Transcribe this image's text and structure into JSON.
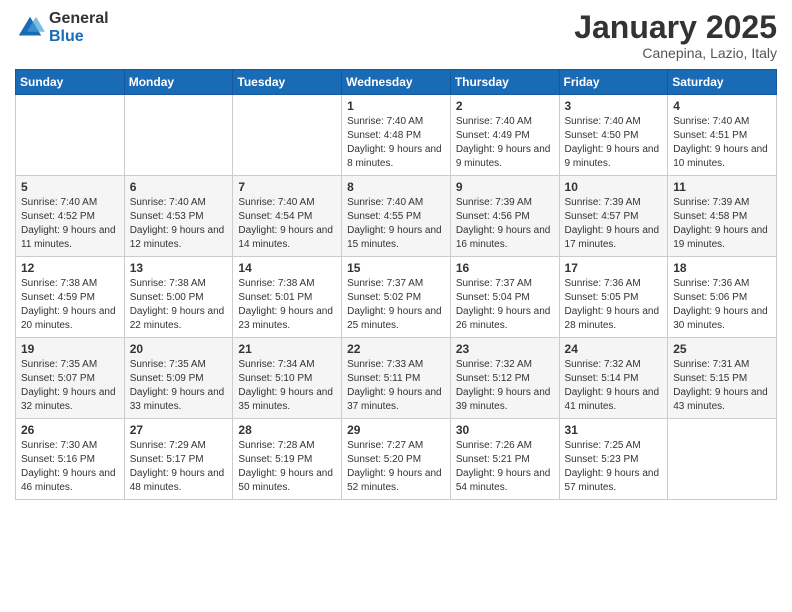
{
  "logo": {
    "general": "General",
    "blue": "Blue"
  },
  "title": {
    "month": "January 2025",
    "location": "Canepina, Lazio, Italy"
  },
  "weekdays": [
    "Sunday",
    "Monday",
    "Tuesday",
    "Wednesday",
    "Thursday",
    "Friday",
    "Saturday"
  ],
  "weeks": [
    [
      {
        "day": "",
        "info": ""
      },
      {
        "day": "",
        "info": ""
      },
      {
        "day": "",
        "info": ""
      },
      {
        "day": "1",
        "info": "Sunrise: 7:40 AM\nSunset: 4:48 PM\nDaylight: 9 hours and 8 minutes."
      },
      {
        "day": "2",
        "info": "Sunrise: 7:40 AM\nSunset: 4:49 PM\nDaylight: 9 hours and 9 minutes."
      },
      {
        "day": "3",
        "info": "Sunrise: 7:40 AM\nSunset: 4:50 PM\nDaylight: 9 hours and 9 minutes."
      },
      {
        "day": "4",
        "info": "Sunrise: 7:40 AM\nSunset: 4:51 PM\nDaylight: 9 hours and 10 minutes."
      }
    ],
    [
      {
        "day": "5",
        "info": "Sunrise: 7:40 AM\nSunset: 4:52 PM\nDaylight: 9 hours and 11 minutes."
      },
      {
        "day": "6",
        "info": "Sunrise: 7:40 AM\nSunset: 4:53 PM\nDaylight: 9 hours and 12 minutes."
      },
      {
        "day": "7",
        "info": "Sunrise: 7:40 AM\nSunset: 4:54 PM\nDaylight: 9 hours and 14 minutes."
      },
      {
        "day": "8",
        "info": "Sunrise: 7:40 AM\nSunset: 4:55 PM\nDaylight: 9 hours and 15 minutes."
      },
      {
        "day": "9",
        "info": "Sunrise: 7:39 AM\nSunset: 4:56 PM\nDaylight: 9 hours and 16 minutes."
      },
      {
        "day": "10",
        "info": "Sunrise: 7:39 AM\nSunset: 4:57 PM\nDaylight: 9 hours and 17 minutes."
      },
      {
        "day": "11",
        "info": "Sunrise: 7:39 AM\nSunset: 4:58 PM\nDaylight: 9 hours and 19 minutes."
      }
    ],
    [
      {
        "day": "12",
        "info": "Sunrise: 7:38 AM\nSunset: 4:59 PM\nDaylight: 9 hours and 20 minutes."
      },
      {
        "day": "13",
        "info": "Sunrise: 7:38 AM\nSunset: 5:00 PM\nDaylight: 9 hours and 22 minutes."
      },
      {
        "day": "14",
        "info": "Sunrise: 7:38 AM\nSunset: 5:01 PM\nDaylight: 9 hours and 23 minutes."
      },
      {
        "day": "15",
        "info": "Sunrise: 7:37 AM\nSunset: 5:02 PM\nDaylight: 9 hours and 25 minutes."
      },
      {
        "day": "16",
        "info": "Sunrise: 7:37 AM\nSunset: 5:04 PM\nDaylight: 9 hours and 26 minutes."
      },
      {
        "day": "17",
        "info": "Sunrise: 7:36 AM\nSunset: 5:05 PM\nDaylight: 9 hours and 28 minutes."
      },
      {
        "day": "18",
        "info": "Sunrise: 7:36 AM\nSunset: 5:06 PM\nDaylight: 9 hours and 30 minutes."
      }
    ],
    [
      {
        "day": "19",
        "info": "Sunrise: 7:35 AM\nSunset: 5:07 PM\nDaylight: 9 hours and 32 minutes."
      },
      {
        "day": "20",
        "info": "Sunrise: 7:35 AM\nSunset: 5:09 PM\nDaylight: 9 hours and 33 minutes."
      },
      {
        "day": "21",
        "info": "Sunrise: 7:34 AM\nSunset: 5:10 PM\nDaylight: 9 hours and 35 minutes."
      },
      {
        "day": "22",
        "info": "Sunrise: 7:33 AM\nSunset: 5:11 PM\nDaylight: 9 hours and 37 minutes."
      },
      {
        "day": "23",
        "info": "Sunrise: 7:32 AM\nSunset: 5:12 PM\nDaylight: 9 hours and 39 minutes."
      },
      {
        "day": "24",
        "info": "Sunrise: 7:32 AM\nSunset: 5:14 PM\nDaylight: 9 hours and 41 minutes."
      },
      {
        "day": "25",
        "info": "Sunrise: 7:31 AM\nSunset: 5:15 PM\nDaylight: 9 hours and 43 minutes."
      }
    ],
    [
      {
        "day": "26",
        "info": "Sunrise: 7:30 AM\nSunset: 5:16 PM\nDaylight: 9 hours and 46 minutes."
      },
      {
        "day": "27",
        "info": "Sunrise: 7:29 AM\nSunset: 5:17 PM\nDaylight: 9 hours and 48 minutes."
      },
      {
        "day": "28",
        "info": "Sunrise: 7:28 AM\nSunset: 5:19 PM\nDaylight: 9 hours and 50 minutes."
      },
      {
        "day": "29",
        "info": "Sunrise: 7:27 AM\nSunset: 5:20 PM\nDaylight: 9 hours and 52 minutes."
      },
      {
        "day": "30",
        "info": "Sunrise: 7:26 AM\nSunset: 5:21 PM\nDaylight: 9 hours and 54 minutes."
      },
      {
        "day": "31",
        "info": "Sunrise: 7:25 AM\nSunset: 5:23 PM\nDaylight: 9 hours and 57 minutes."
      },
      {
        "day": "",
        "info": ""
      }
    ]
  ]
}
